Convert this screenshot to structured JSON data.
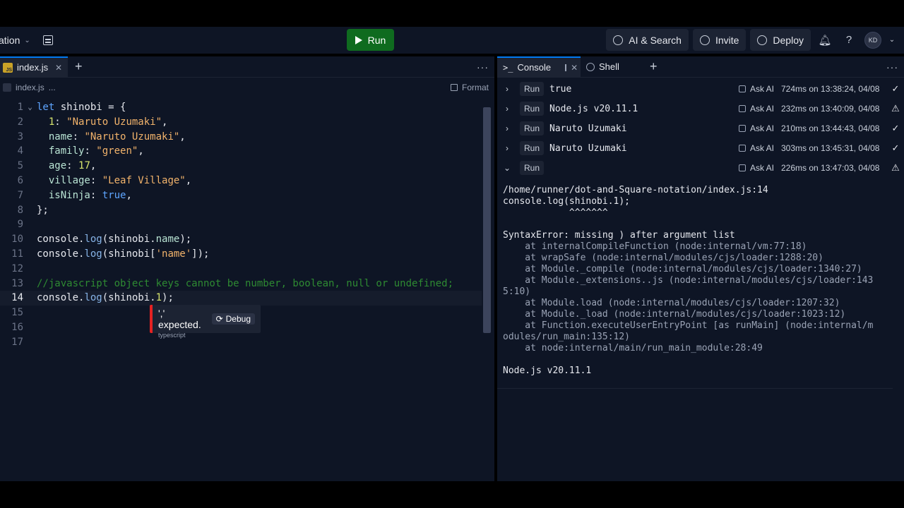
{
  "topbar": {
    "project_name": "ation",
    "run_label": "Run",
    "ai_search_label": "AI & Search",
    "invite_label": "Invite",
    "deploy_label": "Deploy",
    "avatar_initials": "KD"
  },
  "editor": {
    "tab_label": "index.js",
    "breadcrumb_file": "index.js",
    "breadcrumb_more": "...",
    "format_label": "Format",
    "error_tooltip": {
      "message": "',' expected.",
      "debug_label": "Debug",
      "source": "typescript"
    }
  },
  "code_lines": [
    {
      "n": "1",
      "fold": "⌄",
      "parts": [
        [
          "kw",
          "let "
        ],
        [
          "txt",
          "shinobi = {"
        ]
      ]
    },
    {
      "n": "2",
      "parts": [
        [
          "txt",
          "  "
        ],
        [
          "num",
          "1"
        ],
        [
          "txt",
          ": "
        ],
        [
          "str",
          "\"Naruto Uzumaki\""
        ],
        [
          "txt",
          ","
        ]
      ]
    },
    {
      "n": "3",
      "parts": [
        [
          "txt",
          "  "
        ],
        [
          "prop",
          "name"
        ],
        [
          "txt",
          ": "
        ],
        [
          "str",
          "\"Naruto Uzumaki\""
        ],
        [
          "txt",
          ","
        ]
      ]
    },
    {
      "n": "4",
      "parts": [
        [
          "txt",
          "  "
        ],
        [
          "prop",
          "family"
        ],
        [
          "txt",
          ": "
        ],
        [
          "str",
          "\"green\""
        ],
        [
          "txt",
          ","
        ]
      ]
    },
    {
      "n": "5",
      "parts": [
        [
          "txt",
          "  "
        ],
        [
          "prop",
          "age"
        ],
        [
          "txt",
          ": "
        ],
        [
          "num",
          "17"
        ],
        [
          "txt",
          ","
        ]
      ]
    },
    {
      "n": "6",
      "parts": [
        [
          "txt",
          "  "
        ],
        [
          "prop",
          "village"
        ],
        [
          "txt",
          ": "
        ],
        [
          "str",
          "\"Leaf Village\""
        ],
        [
          "txt",
          ","
        ]
      ]
    },
    {
      "n": "7",
      "parts": [
        [
          "txt",
          "  "
        ],
        [
          "prop",
          "isNinja"
        ],
        [
          "txt",
          ": "
        ],
        [
          "bool",
          "true"
        ],
        [
          "txt",
          ","
        ]
      ]
    },
    {
      "n": "8",
      "parts": [
        [
          "txt",
          "};"
        ]
      ]
    },
    {
      "n": "9",
      "parts": []
    },
    {
      "n": "10",
      "parts": [
        [
          "txt",
          "console."
        ],
        [
          "meth",
          "log"
        ],
        [
          "txt",
          "(shinobi."
        ],
        [
          "prop",
          "name"
        ],
        [
          "txt",
          ");"
        ]
      ]
    },
    {
      "n": "11",
      "parts": [
        [
          "txt",
          "console."
        ],
        [
          "meth",
          "log"
        ],
        [
          "txt",
          "(shinobi["
        ],
        [
          "str",
          "'name'"
        ],
        [
          "txt",
          "]);"
        ]
      ]
    },
    {
      "n": "12",
      "parts": []
    },
    {
      "n": "13",
      "parts": [
        [
          "cmt",
          "//javascript object keys cannot be number, boolean, null or undefined;"
        ]
      ]
    },
    {
      "n": "14",
      "active": true,
      "parts": [
        [
          "txt",
          "console."
        ],
        [
          "meth",
          "log"
        ],
        [
          "txt",
          "(shinobi."
        ],
        [
          "num",
          "1"
        ],
        [
          "txt",
          ");"
        ]
      ]
    },
    {
      "n": "15",
      "parts": []
    },
    {
      "n": "16",
      "parts": []
    },
    {
      "n": "17",
      "parts": []
    }
  ],
  "console": {
    "tab_console": "Console",
    "tab_shell": "Shell",
    "runs": [
      {
        "arrow": "›",
        "run": "Run",
        "output": "true",
        "ask": "Ask AI",
        "meta": "724ms on 13:38:24, 04/08",
        "status": "✓"
      },
      {
        "arrow": "›",
        "run": "Run",
        "output": "Node.js v20.11.1",
        "ask": "Ask AI",
        "meta": "232ms on 13:40:09, 04/08",
        "status": "⚠"
      },
      {
        "arrow": "›",
        "run": "Run",
        "output": "Naruto Uzumaki",
        "ask": "Ask AI",
        "meta": "210ms on 13:44:43, 04/08",
        "status": "✓"
      },
      {
        "arrow": "›",
        "run": "Run",
        "output": "Naruto Uzumaki",
        "ask": "Ask AI",
        "meta": "303ms on 13:45:31, 04/08",
        "status": "✓"
      },
      {
        "arrow": "⌄",
        "run": "Run",
        "output": "",
        "ask": "Ask AI",
        "meta": "226ms on 13:47:03, 04/08",
        "status": "⚠"
      }
    ],
    "output_lines": [
      {
        "cls": "",
        "text": "/home/runner/dot-and-Square-notation/index.js:14"
      },
      {
        "cls": "",
        "text": "console.log(shinobi.1);"
      },
      {
        "cls": "",
        "text": "            ^^^^^^^"
      },
      {
        "cls": "",
        "text": ""
      },
      {
        "cls": "",
        "text": "SyntaxError: missing ) after argument list"
      },
      {
        "cls": "out-dim",
        "text": "    at internalCompileFunction (node:internal/vm:77:18)"
      },
      {
        "cls": "out-dim",
        "text": "    at wrapSafe (node:internal/modules/cjs/loader:1288:20)"
      },
      {
        "cls": "out-dim",
        "text": "    at Module._compile (node:internal/modules/cjs/loader:1340:27)"
      },
      {
        "cls": "out-dim",
        "text": "    at Module._extensions..js (node:internal/modules/cjs/loader:143"
      },
      {
        "cls": "out-dim",
        "text": "5:10)"
      },
      {
        "cls": "out-dim",
        "text": "    at Module.load (node:internal/modules/cjs/loader:1207:32)"
      },
      {
        "cls": "out-dim",
        "text": "    at Module._load (node:internal/modules/cjs/loader:1023:12)"
      },
      {
        "cls": "out-dim",
        "text": "    at Function.executeUserEntryPoint [as runMain] (node:internal/m"
      },
      {
        "cls": "out-dim",
        "text": "odules/run_main:135:12)"
      },
      {
        "cls": "out-dim",
        "text": "    at node:internal/main/run_main_module:28:49"
      },
      {
        "cls": "",
        "text": ""
      },
      {
        "cls": "",
        "text": "Node.js v20.11.1"
      }
    ]
  }
}
